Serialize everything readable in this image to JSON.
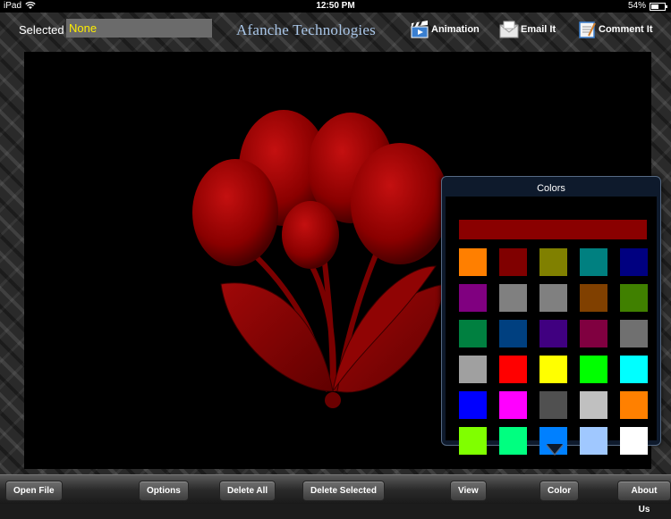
{
  "status_bar": {
    "carrier": "iPad",
    "time": "12:50 PM",
    "battery": "54%",
    "battery_level": 0.54
  },
  "header": {
    "selected_label": "Selected",
    "selected_value": "None",
    "brand": "Afanche Technologies",
    "buttons": [
      {
        "label": "Animation",
        "icon": "clapperboard-icon"
      },
      {
        "label": "Email It",
        "icon": "envelope-icon"
      },
      {
        "label": "Comment It",
        "icon": "notepad-icon"
      }
    ]
  },
  "colors_popover": {
    "title": "Colors",
    "current_color": "#8a0000",
    "swatches": [
      [
        "#ff7f00",
        "#800000",
        "#808000",
        "#008080",
        "#000080"
      ],
      [
        "#800080",
        "#808080",
        "#808080",
        "#804000",
        "#408000"
      ],
      [
        "#008040",
        "#004080",
        "#400080",
        "#800040",
        "#707070"
      ],
      [
        "#a0a0a0",
        "#ff0000",
        "#ffff00",
        "#00ff00",
        "#00ffff"
      ],
      [
        "#0000ff",
        "#ff00ff",
        "#505050",
        "#c0c0c0",
        "#ff8000"
      ],
      [
        "#80ff00",
        "#00ff80",
        "#0080ff",
        "#a0c8ff",
        "#ffffff"
      ]
    ]
  },
  "canvas": {
    "model_color": "#8a0000"
  },
  "toolbar": {
    "buttons": [
      "Open File",
      "Options",
      "Delete All",
      "Delete Selected",
      "View",
      "Color",
      "About Us"
    ]
  }
}
